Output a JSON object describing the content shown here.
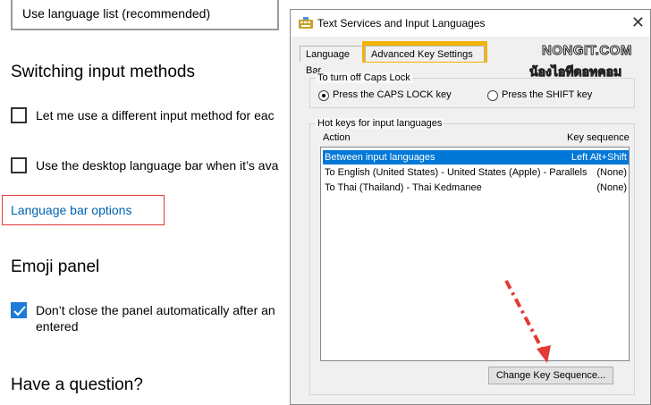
{
  "settings": {
    "dropdown_value": "Use language list (recommended)",
    "switching_heading": "Switching input methods",
    "checkbox_different_method": "Let me use a different input method for eac",
    "checkbox_desktop_bar": "Use the desktop language bar when it’s ava",
    "language_bar_link": "Language bar options",
    "emoji_heading": "Emoji panel",
    "emoji_checkbox_line1": "Don’t close the panel automatically after an",
    "emoji_checkbox_line2": "entered",
    "question_heading": "Have a question?"
  },
  "dialog": {
    "title": "Text Services and Input Languages",
    "close": "✕",
    "tabs": [
      {
        "label": "Language Bar"
      },
      {
        "label": "Advanced Key Settings"
      }
    ],
    "caps_group_label": "To turn off Caps Lock",
    "caps_option_1": "Press the CAPS LOCK key",
    "caps_option_2": "Press the SHIFT key",
    "hotkeys_group_label": "Hot keys for input languages",
    "col_action": "Action",
    "col_key": "Key sequence",
    "rows": [
      {
        "action": "Between input languages",
        "key": "Left Alt+Shift"
      },
      {
        "action": "To English (United States) - United States (Apple) - Parallels",
        "key": "(None)"
      },
      {
        "action": "To Thai (Thailand) - Thai Kedmanee",
        "key": "(None)"
      }
    ],
    "change_button": "Change Key Sequence..."
  },
  "watermark": {
    "line1": "NONGIT.COM",
    "line2": "น้องไอทีดอทคอม"
  },
  "colors": {
    "accent_blue": "#0078d7",
    "link_blue": "#0063b1",
    "highlight_orange": "#f5b301",
    "annotation_red": "#e53935"
  }
}
